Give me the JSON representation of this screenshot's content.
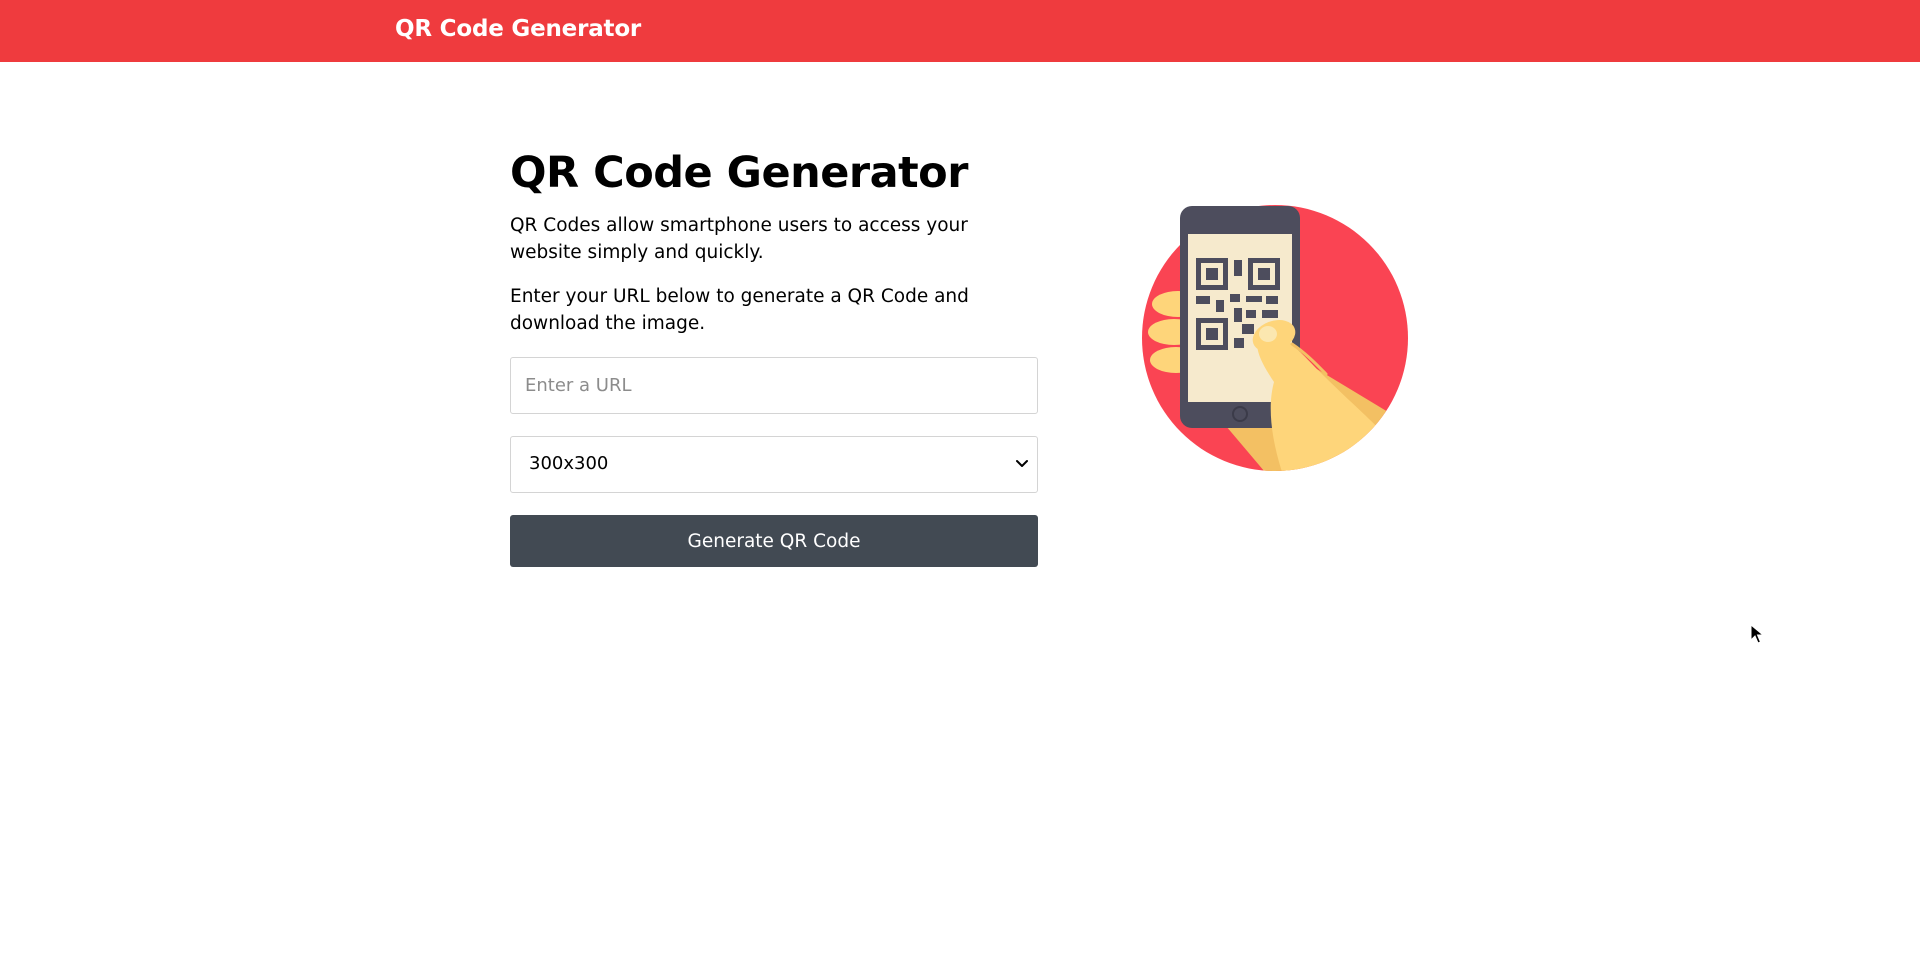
{
  "header": {
    "brand": "QR Code Generator"
  },
  "main": {
    "title": "QR Code Generator",
    "intro": "QR Codes allow smartphone users to access your website simply and quickly.",
    "instructions": "Enter your URL below to generate a QR Code and download the image.",
    "url_input": {
      "placeholder": "Enter a URL",
      "value": ""
    },
    "size_select": {
      "selected": "300x300"
    },
    "generate_label": "Generate QR Code"
  },
  "colors": {
    "header_bg": "#ef3b3e",
    "button_bg": "#424a53",
    "illustration_circle": "#fa4453",
    "phone_body": "#4d4d5d",
    "screen_bg": "#f6eacd",
    "hand": "#fed57a"
  },
  "icons": {
    "illustration": "hand-holding-phone-with-qr-code",
    "select_arrow": "chevron-down-icon"
  }
}
